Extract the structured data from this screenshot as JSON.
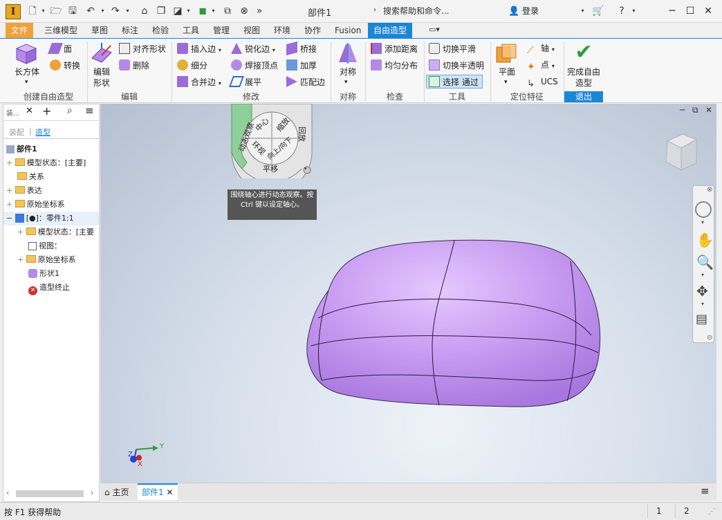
{
  "app": {
    "logo_letter": "I",
    "doc_title": "部件1",
    "help_search": "搜索帮助和命令...",
    "login": "登录"
  },
  "tabs": [
    "文件",
    "三维模型",
    "草图",
    "标注",
    "检验",
    "工具",
    "管理",
    "视图",
    "环境",
    "协作",
    "Fusion",
    "自由造型"
  ],
  "ribbon": {
    "create": {
      "box": "长方体",
      "face": "面",
      "convert": "转换",
      "title": "创建自由造型"
    },
    "edit": {
      "edit_form": "编辑形状",
      "align": "对齐形状",
      "delete": "删除",
      "title": "编辑"
    },
    "modify": {
      "insert_edge": "插入边",
      "subdivide": "细分",
      "merge_edge": "合并边",
      "crease_edge": "锐化边",
      "weld_vertex": "焊接顶点",
      "flatten": "展平",
      "bridge": "桥接",
      "thicken": "加厚",
      "match_edge": "匹配边",
      "title": "修改"
    },
    "symmetry": {
      "label": "对称",
      "title": "对称"
    },
    "inspect": {
      "add_distance": "添加距离",
      "uniform": "均匀分布",
      "title": "检查"
    },
    "tools": {
      "toggle_smooth": "切换平滑",
      "toggle_trans": "切换半透明",
      "select": "选择 通过",
      "title": "工具"
    },
    "workfeat": {
      "plane": "平面",
      "axis": "轴",
      "point": "点",
      "ucs": "UCS",
      "title": "定位特征"
    },
    "exit": {
      "finish": "完成自由造型",
      "title": "退出"
    }
  },
  "browser": {
    "tab_label": "装...",
    "sub_assembly": "装配",
    "sub_model": "造型",
    "items": [
      "部件1",
      "模型状态：[主要]",
      "关系",
      "表达",
      "原始坐标系",
      "[●]：零件1:1",
      "模型状态：[主要",
      "视图：",
      "原始坐标系",
      "形状1",
      "造型终止"
    ]
  },
  "wheel": {
    "orbit": "动态观察",
    "center": "中心",
    "zoom": "缩放",
    "rewind": "回放",
    "updown": "向上/向下",
    "look": "环视",
    "pan": "平移",
    "tooltip": "围绕轴心进行动态观察。按 Ctrl 键以设定轴心。"
  },
  "axis": {
    "x": "X",
    "y": "Y",
    "z": "Z"
  },
  "doctabs": {
    "home": "主页",
    "doc": "部件1"
  },
  "status": {
    "help": "按 F1 获得帮助",
    "n1": "1",
    "n2": "2"
  },
  "colors": {
    "accent": "#1c86d6",
    "file_tab": "#f0a13b",
    "shape": "#c79cf0"
  }
}
